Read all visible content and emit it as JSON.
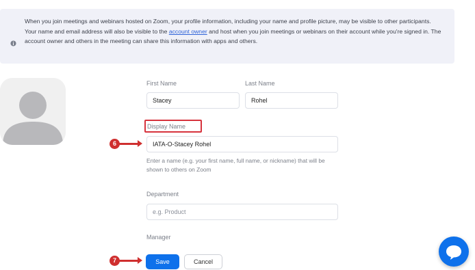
{
  "notice": {
    "icon": "info-icon",
    "text_before": "When you join meetings and webinars hosted on Zoom, your profile information, including your name and profile picture, may be visible to other participants. Your name and email address will also be visible to the ",
    "link_text": "account owner",
    "text_after": " and host when you join meetings or webinars on their account while you're signed in. The account owner and others in the meeting can share this information with apps and others."
  },
  "profile": {
    "first_name": {
      "label": "First Name",
      "value": "Stacey"
    },
    "last_name": {
      "label": "Last Name",
      "value": "Rohel"
    },
    "display_name": {
      "label": "Display Name",
      "value": "IATA-O-Stacey Rohel",
      "help": "Enter a name (e.g. your first name, full name, or nickname) that will be shown to others on Zoom"
    },
    "department": {
      "label": "Department",
      "placeholder": "e.g. Product"
    },
    "manager": {
      "label": "Manager"
    }
  },
  "actions": {
    "save": "Save",
    "cancel": "Cancel"
  },
  "annotations": {
    "step6": "6",
    "step7": "7",
    "color": "#cf2f2f"
  },
  "colors": {
    "primary": "#0e71eb",
    "notice_bg": "#f0f1f8"
  },
  "chat": {
    "icon": "chat-bubble-icon"
  }
}
